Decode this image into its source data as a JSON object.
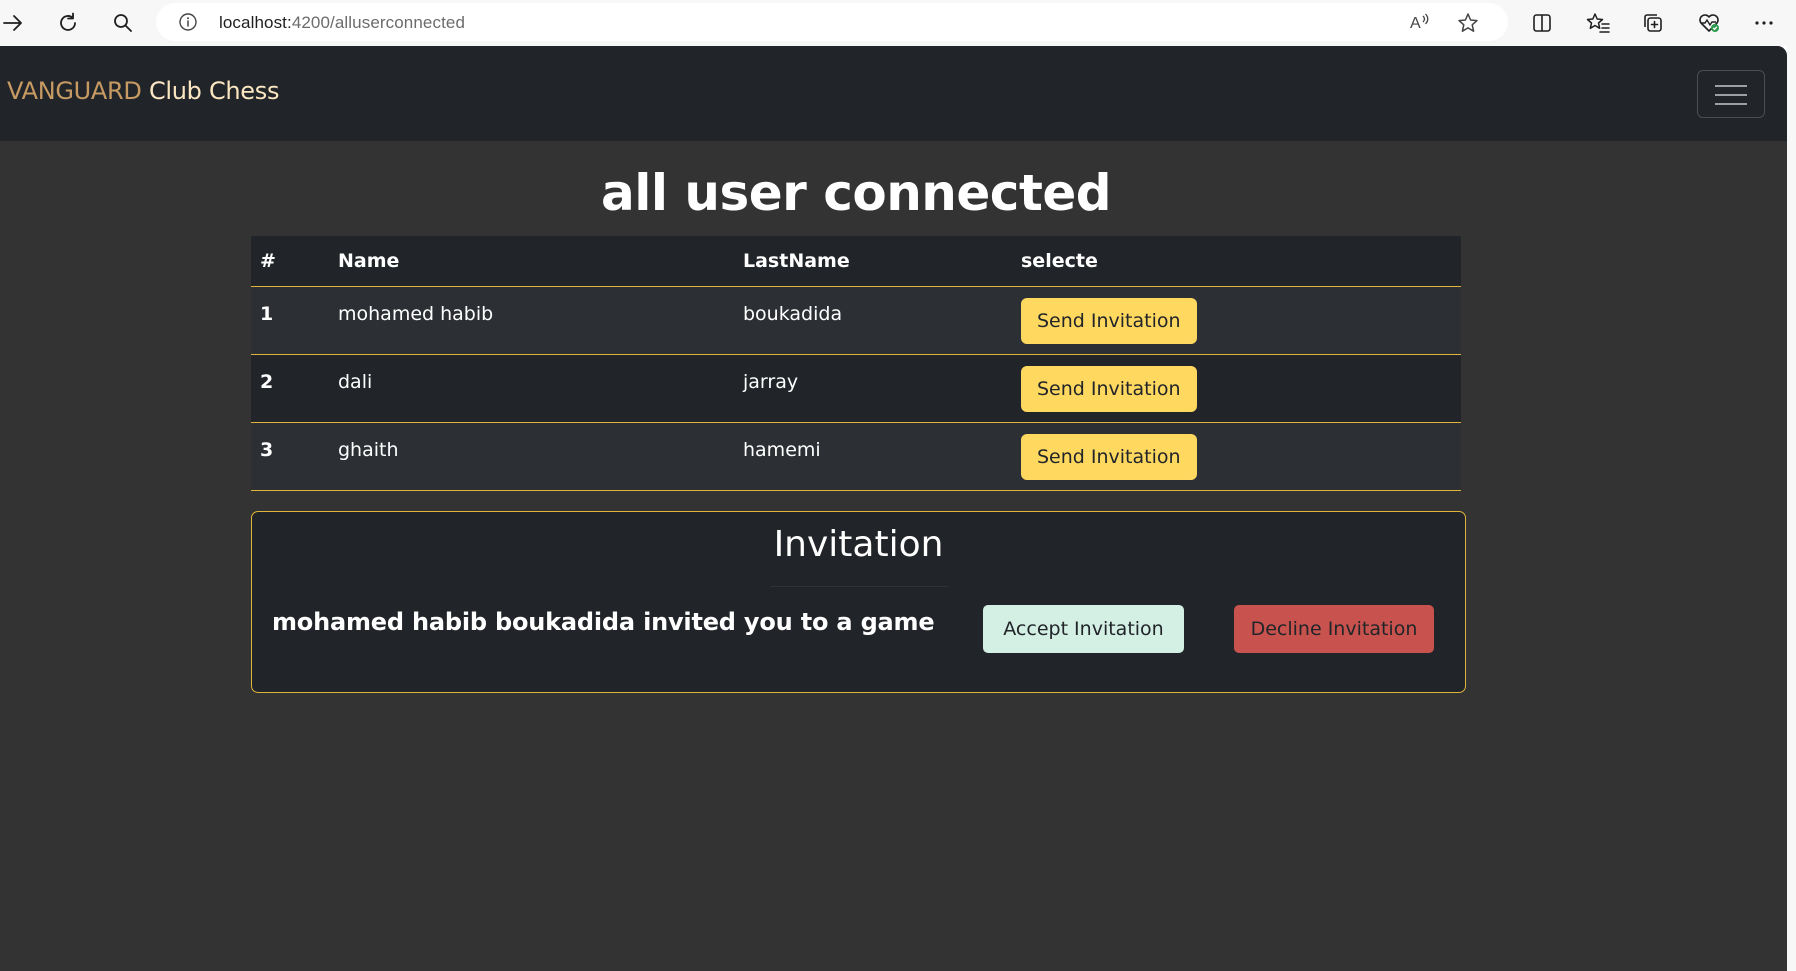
{
  "browser": {
    "url_host": "localhost:",
    "url_path": "4200/alluserconnected"
  },
  "navbar": {
    "brand_part1": "VANGUARD",
    "brand_part2": "Club Chess"
  },
  "page": {
    "title": "all user connected"
  },
  "table": {
    "headers": [
      "#",
      "Name",
      "LastName",
      "selecte"
    ],
    "rows": [
      {
        "num": "1",
        "name": "mohamed habib",
        "lastname": "boukadida",
        "action": "Send Invitation"
      },
      {
        "num": "2",
        "name": "dali",
        "lastname": "jarray",
        "action": "Send Invitation"
      },
      {
        "num": "3",
        "name": "ghaith",
        "lastname": "hamemi",
        "action": "Send Invitation"
      }
    ]
  },
  "invitation": {
    "title": "Invitation",
    "message": "mohamed habib boukadida invited you to a game",
    "accept_label": "Accept Invitation",
    "decline_label": "Decline Invitation"
  },
  "icons": {
    "back": "arrow-right-icon",
    "reload": "reload-icon",
    "search": "search-icon",
    "site_info": "info-icon",
    "read_aloud": "read-aloud-icon",
    "favorite": "star-icon",
    "split_screen": "split-screen-icon",
    "favorites": "favorites-icon",
    "collections": "collections-icon",
    "browser_essentials": "heart-pulse-icon",
    "more": "more-icon",
    "menu": "hamburger-icon"
  },
  "colors": {
    "navbar_bg": "#212529",
    "page_bg": "#333333",
    "accent_yellow": "#ffd860",
    "border_gold": "#e0b43a",
    "accept_bg": "#d4efe4",
    "decline_bg": "#c8524e"
  }
}
